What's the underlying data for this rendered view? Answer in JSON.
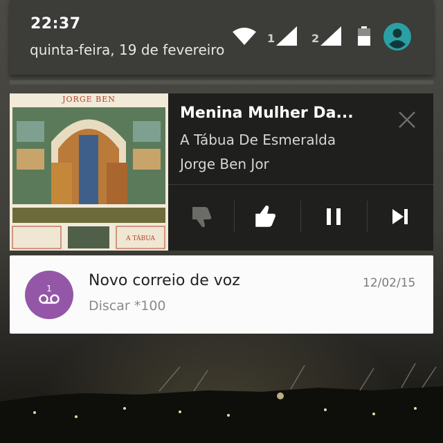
{
  "status_bar": {
    "time": "22:37",
    "date": "quinta-feira, 19 de fevereiro",
    "sim1_label": "1",
    "sim2_label": "2",
    "icons": [
      "wifi-icon",
      "signal-icon",
      "signal-icon",
      "battery-icon",
      "user-avatar-icon"
    ]
  },
  "media_notification": {
    "album_art_text": "JORGE BEN",
    "song_title": "Menina Mulher Da...",
    "album": "A Tábua De Esmeralda",
    "artist": "Jorge Ben Jor",
    "controls": [
      "thumbs-down-icon",
      "thumbs-up-icon",
      "pause-icon",
      "skip-next-icon"
    ],
    "close_icon": "close-icon"
  },
  "voicemail_notification": {
    "badge_count": "1",
    "title": "Novo correio de voz",
    "subtitle": "Discar *100",
    "date": "12/02/15",
    "avatar_color": "#9457a8"
  }
}
